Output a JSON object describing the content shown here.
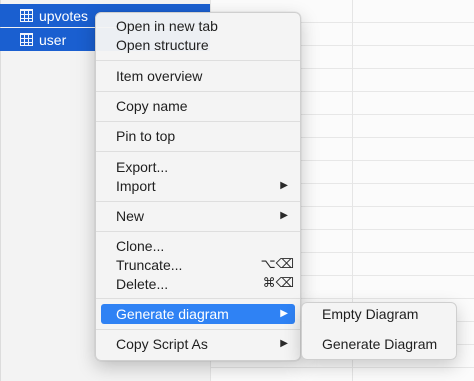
{
  "tree": {
    "rows": [
      {
        "label": "upvotes",
        "icon": "table-icon"
      },
      {
        "label": "user",
        "icon": "table-icon"
      }
    ]
  },
  "menu": {
    "open_new_tab": "Open in new tab",
    "open_structure": "Open structure",
    "item_overview": "Item overview",
    "copy_name": "Copy name",
    "pin_to_top": "Pin to top",
    "export": "Export...",
    "import": "Import",
    "new": "New",
    "clone": "Clone...",
    "truncate": "Truncate...",
    "truncate_shortcut": "⌥⌫",
    "delete": "Delete...",
    "delete_shortcut": "⌘⌫",
    "generate_diagram": "Generate diagram",
    "copy_script_as": "Copy Script As",
    "arrow": "▶"
  },
  "submenu": {
    "empty_diagram": "Empty Diagram",
    "generate_diagram": "Generate Diagram"
  },
  "colors": {
    "selection": "#1a5fd0",
    "highlight": "#2f82f4"
  }
}
